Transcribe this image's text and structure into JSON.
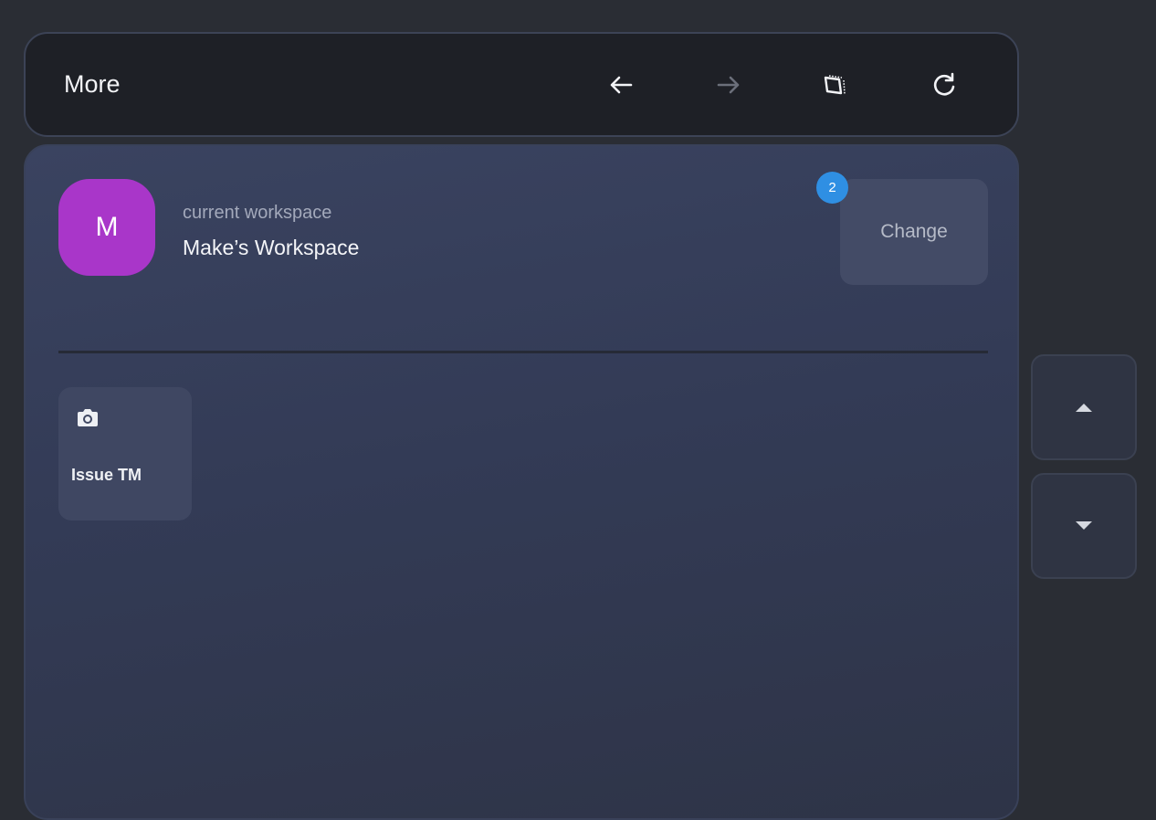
{
  "header": {
    "title": "More",
    "icons": [
      "arrow-left-icon",
      "arrow-right-icon",
      "screen-rotate-icon",
      "refresh-icon"
    ]
  },
  "workspace": {
    "avatar_letter": "M",
    "caption": "current workspace",
    "name": "Make’s Workspace",
    "change_label": "Change",
    "badge_count": "2"
  },
  "tiles": [
    {
      "label": "Issue TM",
      "icon": "camera-icon"
    }
  ],
  "scroll": {
    "up_icon": "caret-up-icon",
    "down_icon": "caret-down-icon"
  },
  "colors": {
    "avatar": "#a936c9",
    "badge": "#2f8fe3",
    "background": "#2a2d34",
    "panel": "#3a4360"
  }
}
